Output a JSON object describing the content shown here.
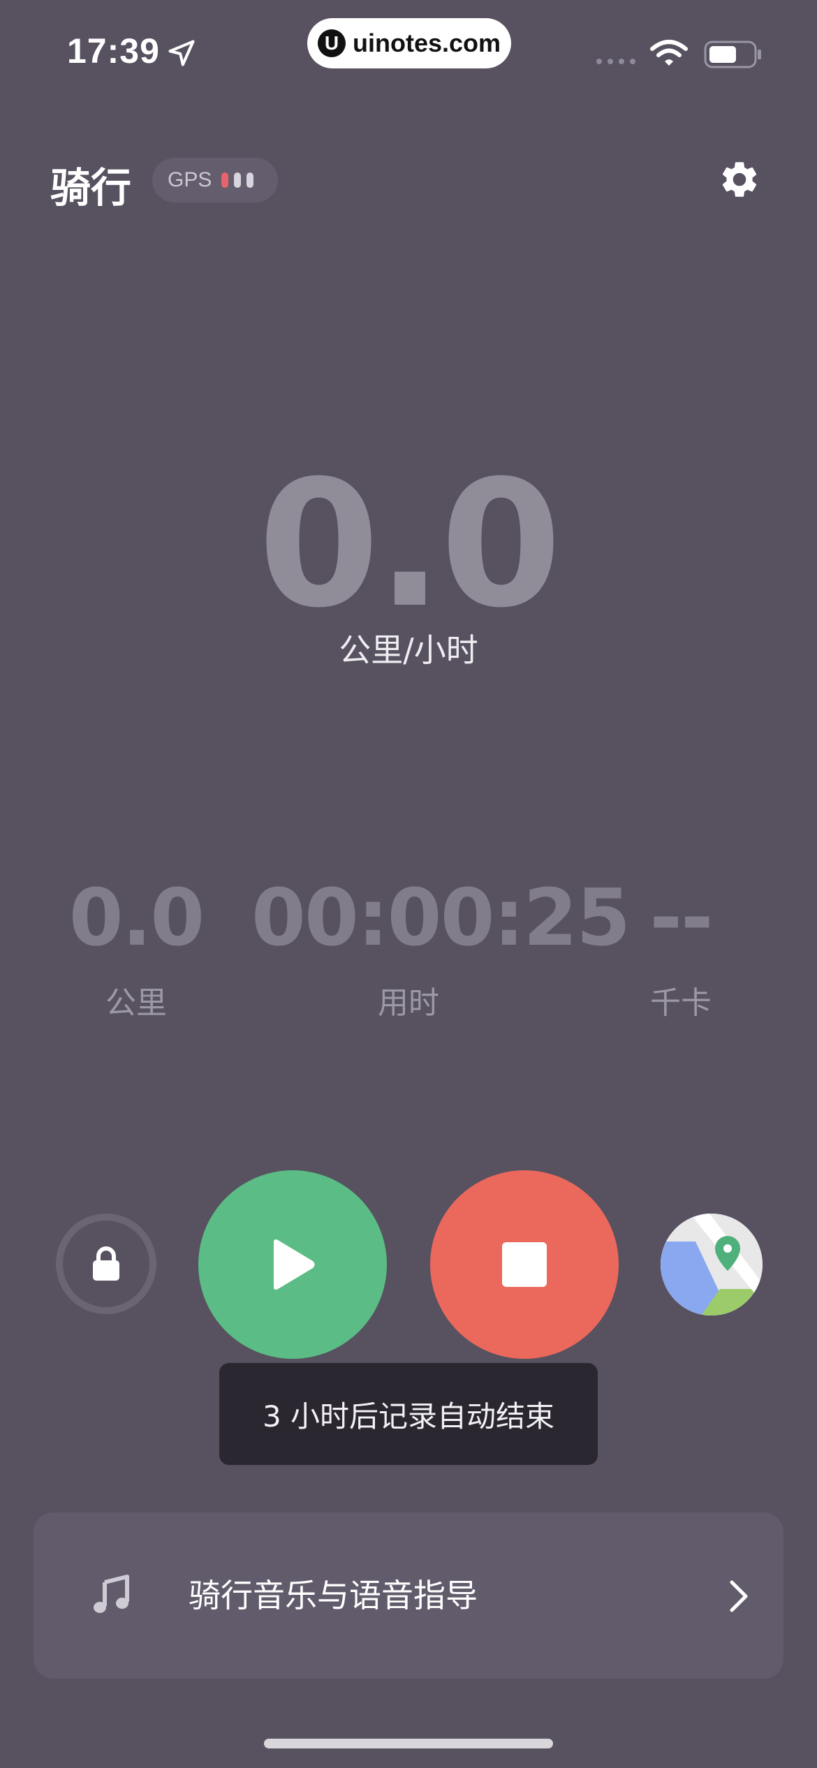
{
  "status_bar": {
    "time": "17:39",
    "url_badge_logo": "U",
    "url": "uinotes.com",
    "icons": [
      "location-arrow-icon",
      "cellular-signal-icon",
      "wifi-icon",
      "battery-icon"
    ]
  },
  "header": {
    "title": "骑行",
    "gps_label": "GPS",
    "gps_signal_colors": [
      "#e8636b",
      "#d8d4dd",
      "#d8d4dd"
    ],
    "settings_icon": "gear-icon"
  },
  "speed": {
    "value": "0.0",
    "unit": "公里/小时"
  },
  "stats": {
    "distance": {
      "value": "0.0",
      "label": "公里"
    },
    "duration": {
      "value": "00:00:25",
      "label": "用时"
    },
    "calories": {
      "value": "--",
      "label": "千卡"
    }
  },
  "controls": {
    "lock_icon": "lock-icon",
    "play_icon": "play-icon",
    "stop_icon": "stop-icon",
    "map_icon": "map-icon",
    "play_color": "#5bbd85",
    "stop_color": "#eb695c"
  },
  "toast": {
    "text": "3 小时后记录自动结束"
  },
  "music_card": {
    "icon": "music-note-icon",
    "label": "骑行音乐与语音指导",
    "chevron_icon": "chevron-right-icon"
  }
}
